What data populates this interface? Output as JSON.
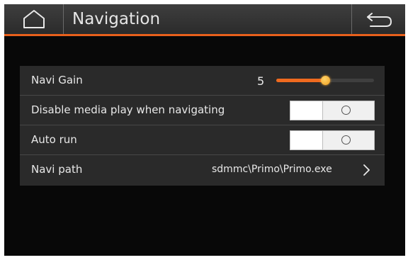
{
  "header": {
    "title": "Navigation",
    "home_icon": "home-icon",
    "back_icon": "back-arrow-icon",
    "accent_color": "#e8601c"
  },
  "settings": {
    "navi_gain": {
      "label": "Navi Gain",
      "value": "5",
      "level": 0.5
    },
    "disable_media": {
      "label": "Disable media play when navigating",
      "state": "off"
    },
    "auto_run": {
      "label": "Auto run",
      "state": "off"
    },
    "navi_path": {
      "label": "Navi path",
      "value": "sdmmc\\Primo\\Primo.exe",
      "icon": "chevron-right-icon"
    }
  }
}
